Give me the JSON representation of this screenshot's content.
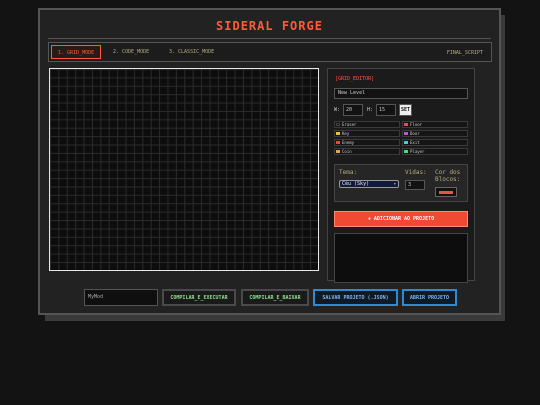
{
  "app": {
    "title": "SIDERAL FORGE"
  },
  "tabs": [
    {
      "label": "1. GRID_MODE",
      "active": true
    },
    {
      "label": "2. CODE_MODE",
      "active": false
    },
    {
      "label": "3. CLASSIC_MODE",
      "active": false
    }
  ],
  "final_script_label": "FINAL_SCRIPT",
  "editor": {
    "header": "[GRID_EDITOR]",
    "level_name": "New Level",
    "width_label": "W:",
    "width_value": "20",
    "height_label": "H:",
    "height_value": "15",
    "set_label": "SET",
    "palette": [
      {
        "label": "Eraser",
        "color": "#111111"
      },
      {
        "label": "Floor",
        "color": "#e24a6a"
      },
      {
        "label": "Key",
        "color": "#e8c23a"
      },
      {
        "label": "Door",
        "color": "#b45ad2"
      },
      {
        "label": "Enemy",
        "color": "#e84a3a"
      },
      {
        "label": "Exit",
        "color": "#3ad2e0"
      },
      {
        "label": "Coin",
        "color": "#e8a83a"
      },
      {
        "label": "Player",
        "color": "#3ae07a"
      }
    ],
    "theme_label": "Tema:",
    "theme_value": "Céu (Sky)",
    "lives_label": "Vidas:",
    "lives_value": "3",
    "block_color_label": "Cor dos Blocos:",
    "add_button": "+ ADICIONAR AO PROJETO"
  },
  "bottom": {
    "mod_name": "MyMod",
    "compile_run": "COMPILAR_E_EXECUTAR",
    "compile_download": "COMPILAR_E_BAIXAR",
    "save_project": "SALVAR PROJETO (.JSON)",
    "open_project": "ABRIR PROJETO"
  },
  "colors": {
    "accent": "#ff5a3c",
    "green": "#8fe08f",
    "blue": "#2f8ad4"
  }
}
